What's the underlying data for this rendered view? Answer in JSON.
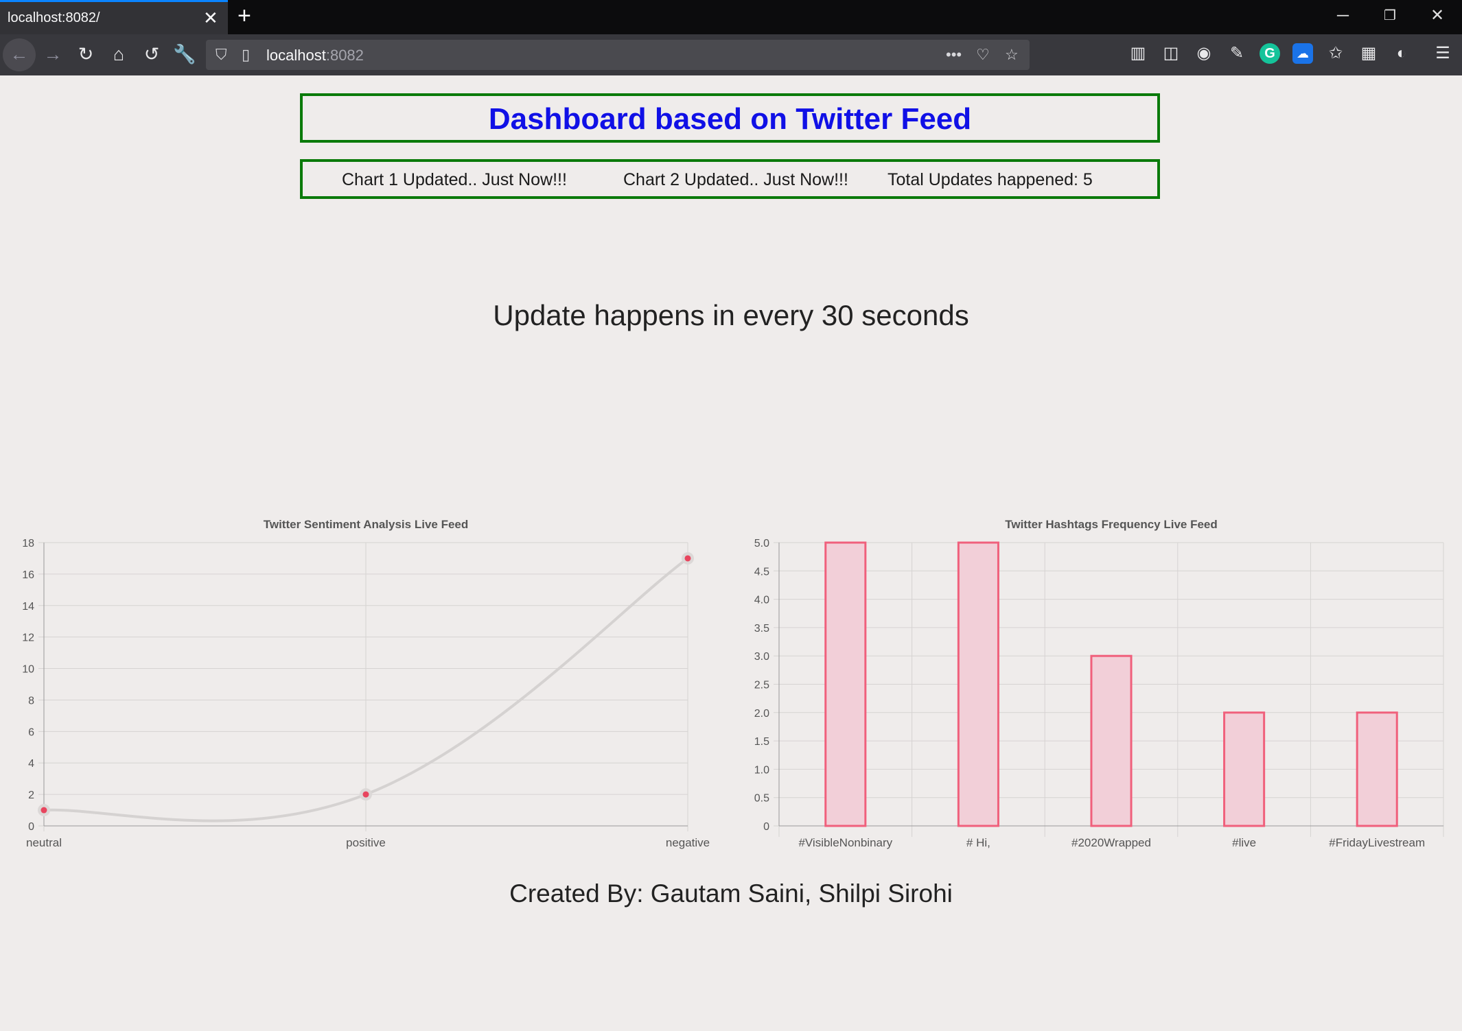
{
  "browser": {
    "tab_title": "localhost:8082/",
    "url_host": "localhost",
    "url_port": ":8082",
    "icons": [
      "back-icon",
      "forward-icon",
      "reload-icon",
      "home-icon",
      "history-icon",
      "wrench-icon",
      "shield-icon",
      "page-icon",
      "more-icon",
      "pocket-icon",
      "star-icon",
      "library-icon",
      "sidebar-icon",
      "account-icon",
      "pen-icon",
      "grammarly-icon",
      "cloud-icon",
      "star-badge-icon",
      "extension-icon",
      "puzzle-icon",
      "menu-icon"
    ]
  },
  "header": {
    "title": "Dashboard based on Twitter Feed",
    "status1": "Chart 1 Updated.. Just Now!!!",
    "status2": "Chart 2 Updated.. Just Now!!!",
    "status3": "Total Updates happened: 5"
  },
  "interval_text": "Update happens in every 30 seconds",
  "credits": "Created By: Gautam Saini, Shilpi Sirohi",
  "colors": {
    "title": "#1010e6",
    "border": "#0a7a0a",
    "bar_stroke": "#f0607c",
    "bar_fill": "#f2cfd8",
    "point": "#e8455e",
    "line": "#d5d2d1"
  },
  "chart_data": [
    {
      "type": "line",
      "title": "Twitter Sentiment Analysis Live Feed",
      "categories": [
        "neutral",
        "positive",
        "negative"
      ],
      "values": [
        1,
        2,
        17
      ],
      "yticks": [
        "0",
        "2",
        "4",
        "6",
        "8",
        "10",
        "12",
        "14",
        "16",
        "18"
      ],
      "ylim": [
        0,
        18
      ],
      "grid": true,
      "smooth": true
    },
    {
      "type": "bar",
      "title": "Twitter Hashtags Frequency Live Feed",
      "categories": [
        "#VisibleNonbinary",
        "# Hi,",
        "#2020Wrapped",
        "#live",
        "#FridayLivestream"
      ],
      "values": [
        5,
        5,
        3,
        2,
        2
      ],
      "yticks": [
        "0",
        "0.5",
        "1.0",
        "1.5",
        "2.0",
        "2.5",
        "3.0",
        "3.5",
        "4.0",
        "4.5",
        "5.0"
      ],
      "ylim": [
        0,
        5
      ],
      "grid": true
    }
  ]
}
